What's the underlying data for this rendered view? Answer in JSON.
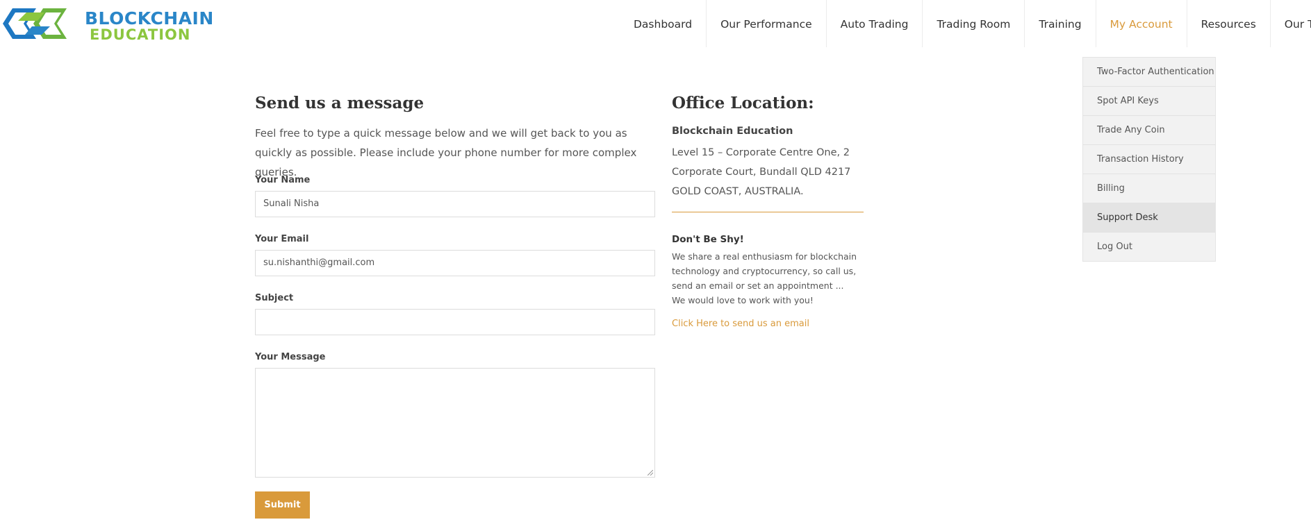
{
  "brand": {
    "line1": "BLOCKCHAIN",
    "line2": "EDUCATION",
    "blue": "#2a86c8",
    "green": "#8cc63f"
  },
  "nav": {
    "items": [
      {
        "label": "Dashboard"
      },
      {
        "label": "Our Performance"
      },
      {
        "label": "Auto Trading"
      },
      {
        "label": "Trading Room"
      },
      {
        "label": "Training"
      },
      {
        "label": "My Account"
      },
      {
        "label": "Resources"
      },
      {
        "label": "Our Team"
      }
    ],
    "active": "My Account",
    "accent_color": "#d99a3b"
  },
  "account_menu": {
    "items": [
      {
        "label": "Two-Factor Authentication"
      },
      {
        "label": "Spot API Keys"
      },
      {
        "label": "Trade Any Coin"
      },
      {
        "label": "Transaction History"
      },
      {
        "label": "Billing"
      },
      {
        "label": "Support Desk"
      },
      {
        "label": "Log Out"
      }
    ],
    "hovered": "Support Desk"
  },
  "form": {
    "heading": "Send us a message",
    "intro": "Feel free to type a quick message below and we will get back to you as quickly as possible. Please include your phone number for more complex queries.",
    "name_label": "Your Name",
    "name_value": "Sunali Nisha",
    "email_label": "Your Email",
    "email_value": "su.nishanthi@gmail.com",
    "subject_label": "Subject",
    "subject_value": "",
    "message_label": "Your Message",
    "message_value": "",
    "submit_label": "Submit"
  },
  "office": {
    "heading": "Office Location:",
    "name": "Blockchain Education",
    "address": "Level 15 – Corporate Centre One, 2 Corporate Court, Bundall QLD 4217 GOLD COAST, AUSTRALIA.",
    "shy_title": "Don't Be Shy!",
    "shy_text_1": "We share a real enthusiasm for blockchain technology and cryptocurrency, so call us, send an email or set an appointment ...",
    "shy_text_2": "We would love to work with you!",
    "email_link": "Click Here to send us an email"
  }
}
